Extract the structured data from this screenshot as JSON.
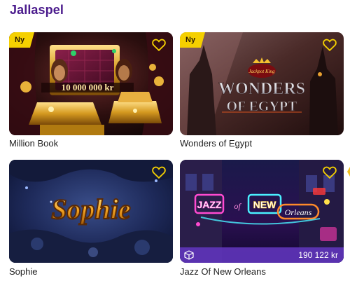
{
  "section": {
    "title": "Jallaspel"
  },
  "badges": {
    "new_label": "Ny"
  },
  "games": [
    {
      "title": "Million Book",
      "is_new": true,
      "art_text": "10 000 000 kr"
    },
    {
      "title": "Wonders of Egypt",
      "is_new": true,
      "logo_small": "Jackpot King",
      "logo_line1": "WONDERS",
      "logo_line2": "OF EGYPT"
    },
    {
      "title": "Sophie",
      "is_new": false,
      "logo": "Sophie"
    },
    {
      "title": "Jazz Of New Orleans",
      "is_new": false,
      "logo_jazz": "JAZZ",
      "logo_new": "NEW",
      "logo_orleans": "Orleans",
      "jackpot": "190 122 kr",
      "jackpot_icon": "cube-icon"
    }
  ],
  "colors": {
    "brand": "#4a1a8c",
    "badge": "#f5d000",
    "jackpot_bar": "#5e34b8"
  }
}
